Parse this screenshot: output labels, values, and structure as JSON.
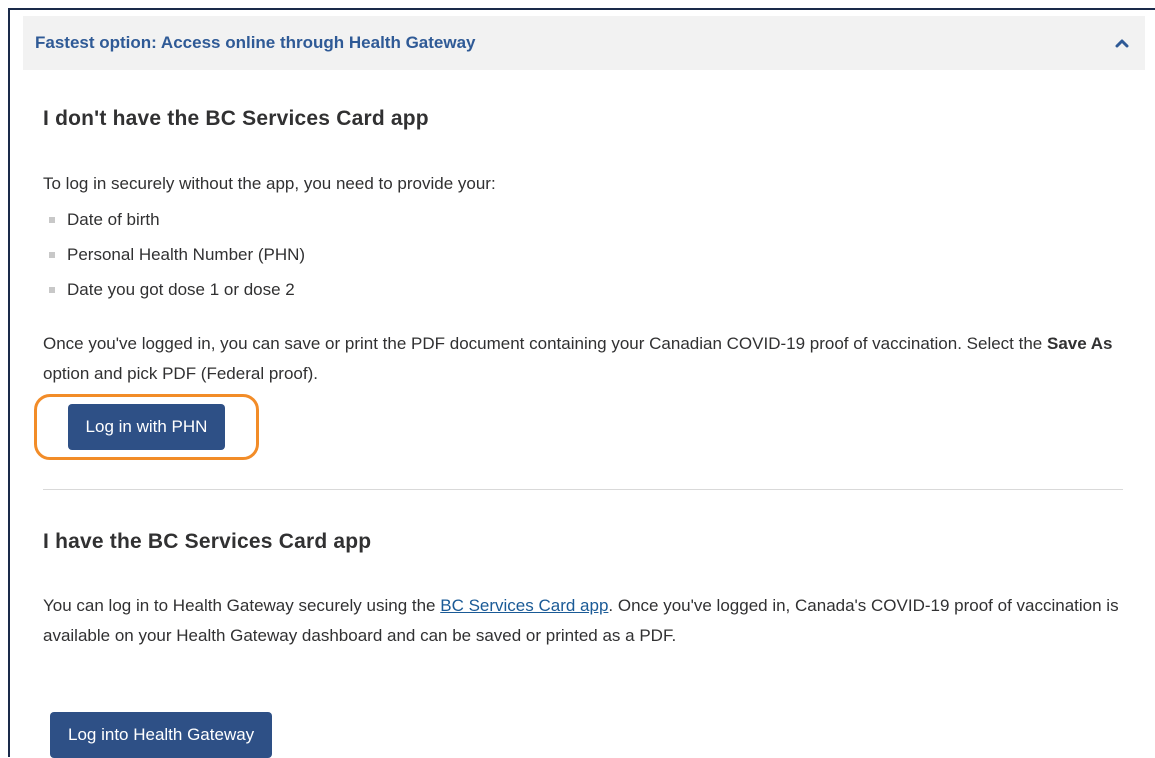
{
  "accordion": {
    "title": "Fastest option: Access online through Health Gateway",
    "toggle_icon": "chevron-up-icon"
  },
  "no_app": {
    "heading": "I don't have the BC Services Card app",
    "intro": "To log in securely without the app, you need to provide your:",
    "items": [
      "Date of birth",
      "Personal Health Number (PHN)",
      "Date you got dose 1 or dose 2"
    ],
    "para_before": "Once you've logged in, you can save or print the PDF document containing your Canadian COVID-19 proof of vaccination. Select the ",
    "para_bold": "Save As",
    "para_after": " option and pick PDF (Federal proof).",
    "button": "Log in with PHN"
  },
  "has_app": {
    "heading": "I have the BC Services Card app",
    "para_before": "You can log in to Health Gateway securely using the ",
    "link": "BC Services Card app",
    "para_after": ". Once you've logged in, Canada's COVID-19 proof of vaccination is available on your Health Gateway dashboard and can be saved or printed as a PDF.",
    "button": "Log into Health Gateway"
  },
  "colors": {
    "header_text": "#2f5a96",
    "button_bg": "#2e5086",
    "highlight": "#f28c28",
    "link": "#1a5a96"
  }
}
